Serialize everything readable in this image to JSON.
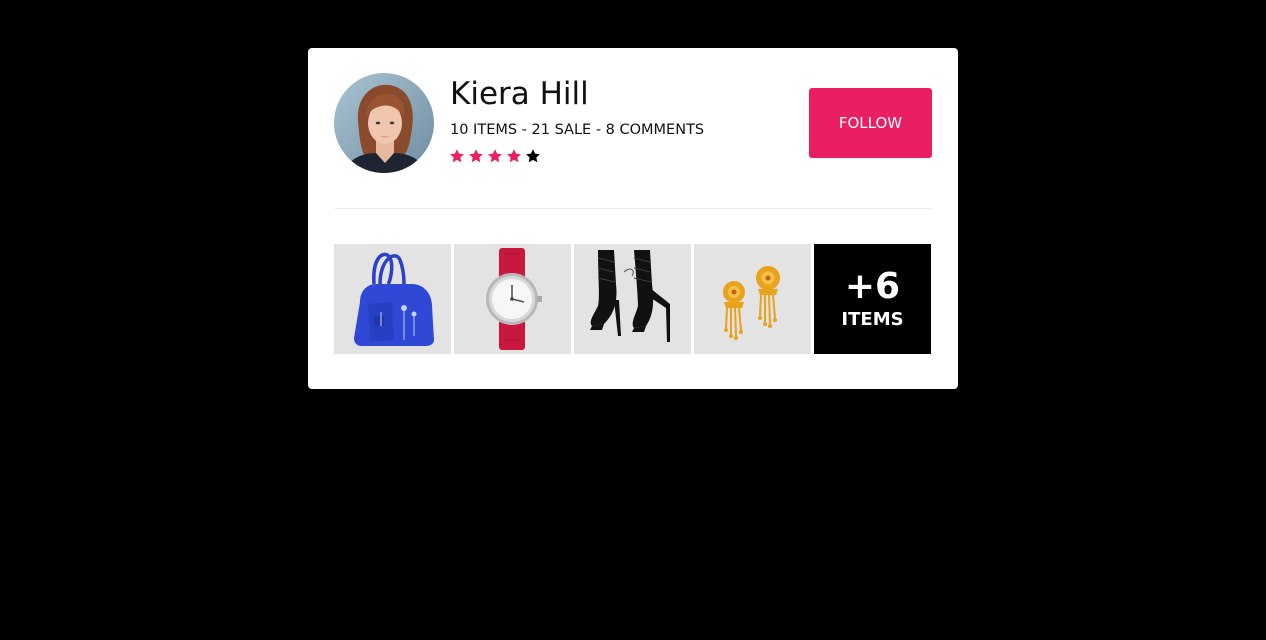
{
  "profile": {
    "name": "Kiera Hill",
    "stats": "10 ITEMS - 21 SALE - 8 COMMENTS",
    "rating": 4,
    "rating_max": 5,
    "star_active_color": "#e91e63",
    "star_inactive_color": "#000000"
  },
  "follow": {
    "label": "FOLLOW",
    "color": "#e91e63"
  },
  "items": [
    {
      "icon": "handbag-icon"
    },
    {
      "icon": "watch-icon"
    },
    {
      "icon": "heels-icon"
    },
    {
      "icon": "earrings-icon"
    }
  ],
  "more": {
    "count": "+6",
    "label": "ITEMS"
  }
}
